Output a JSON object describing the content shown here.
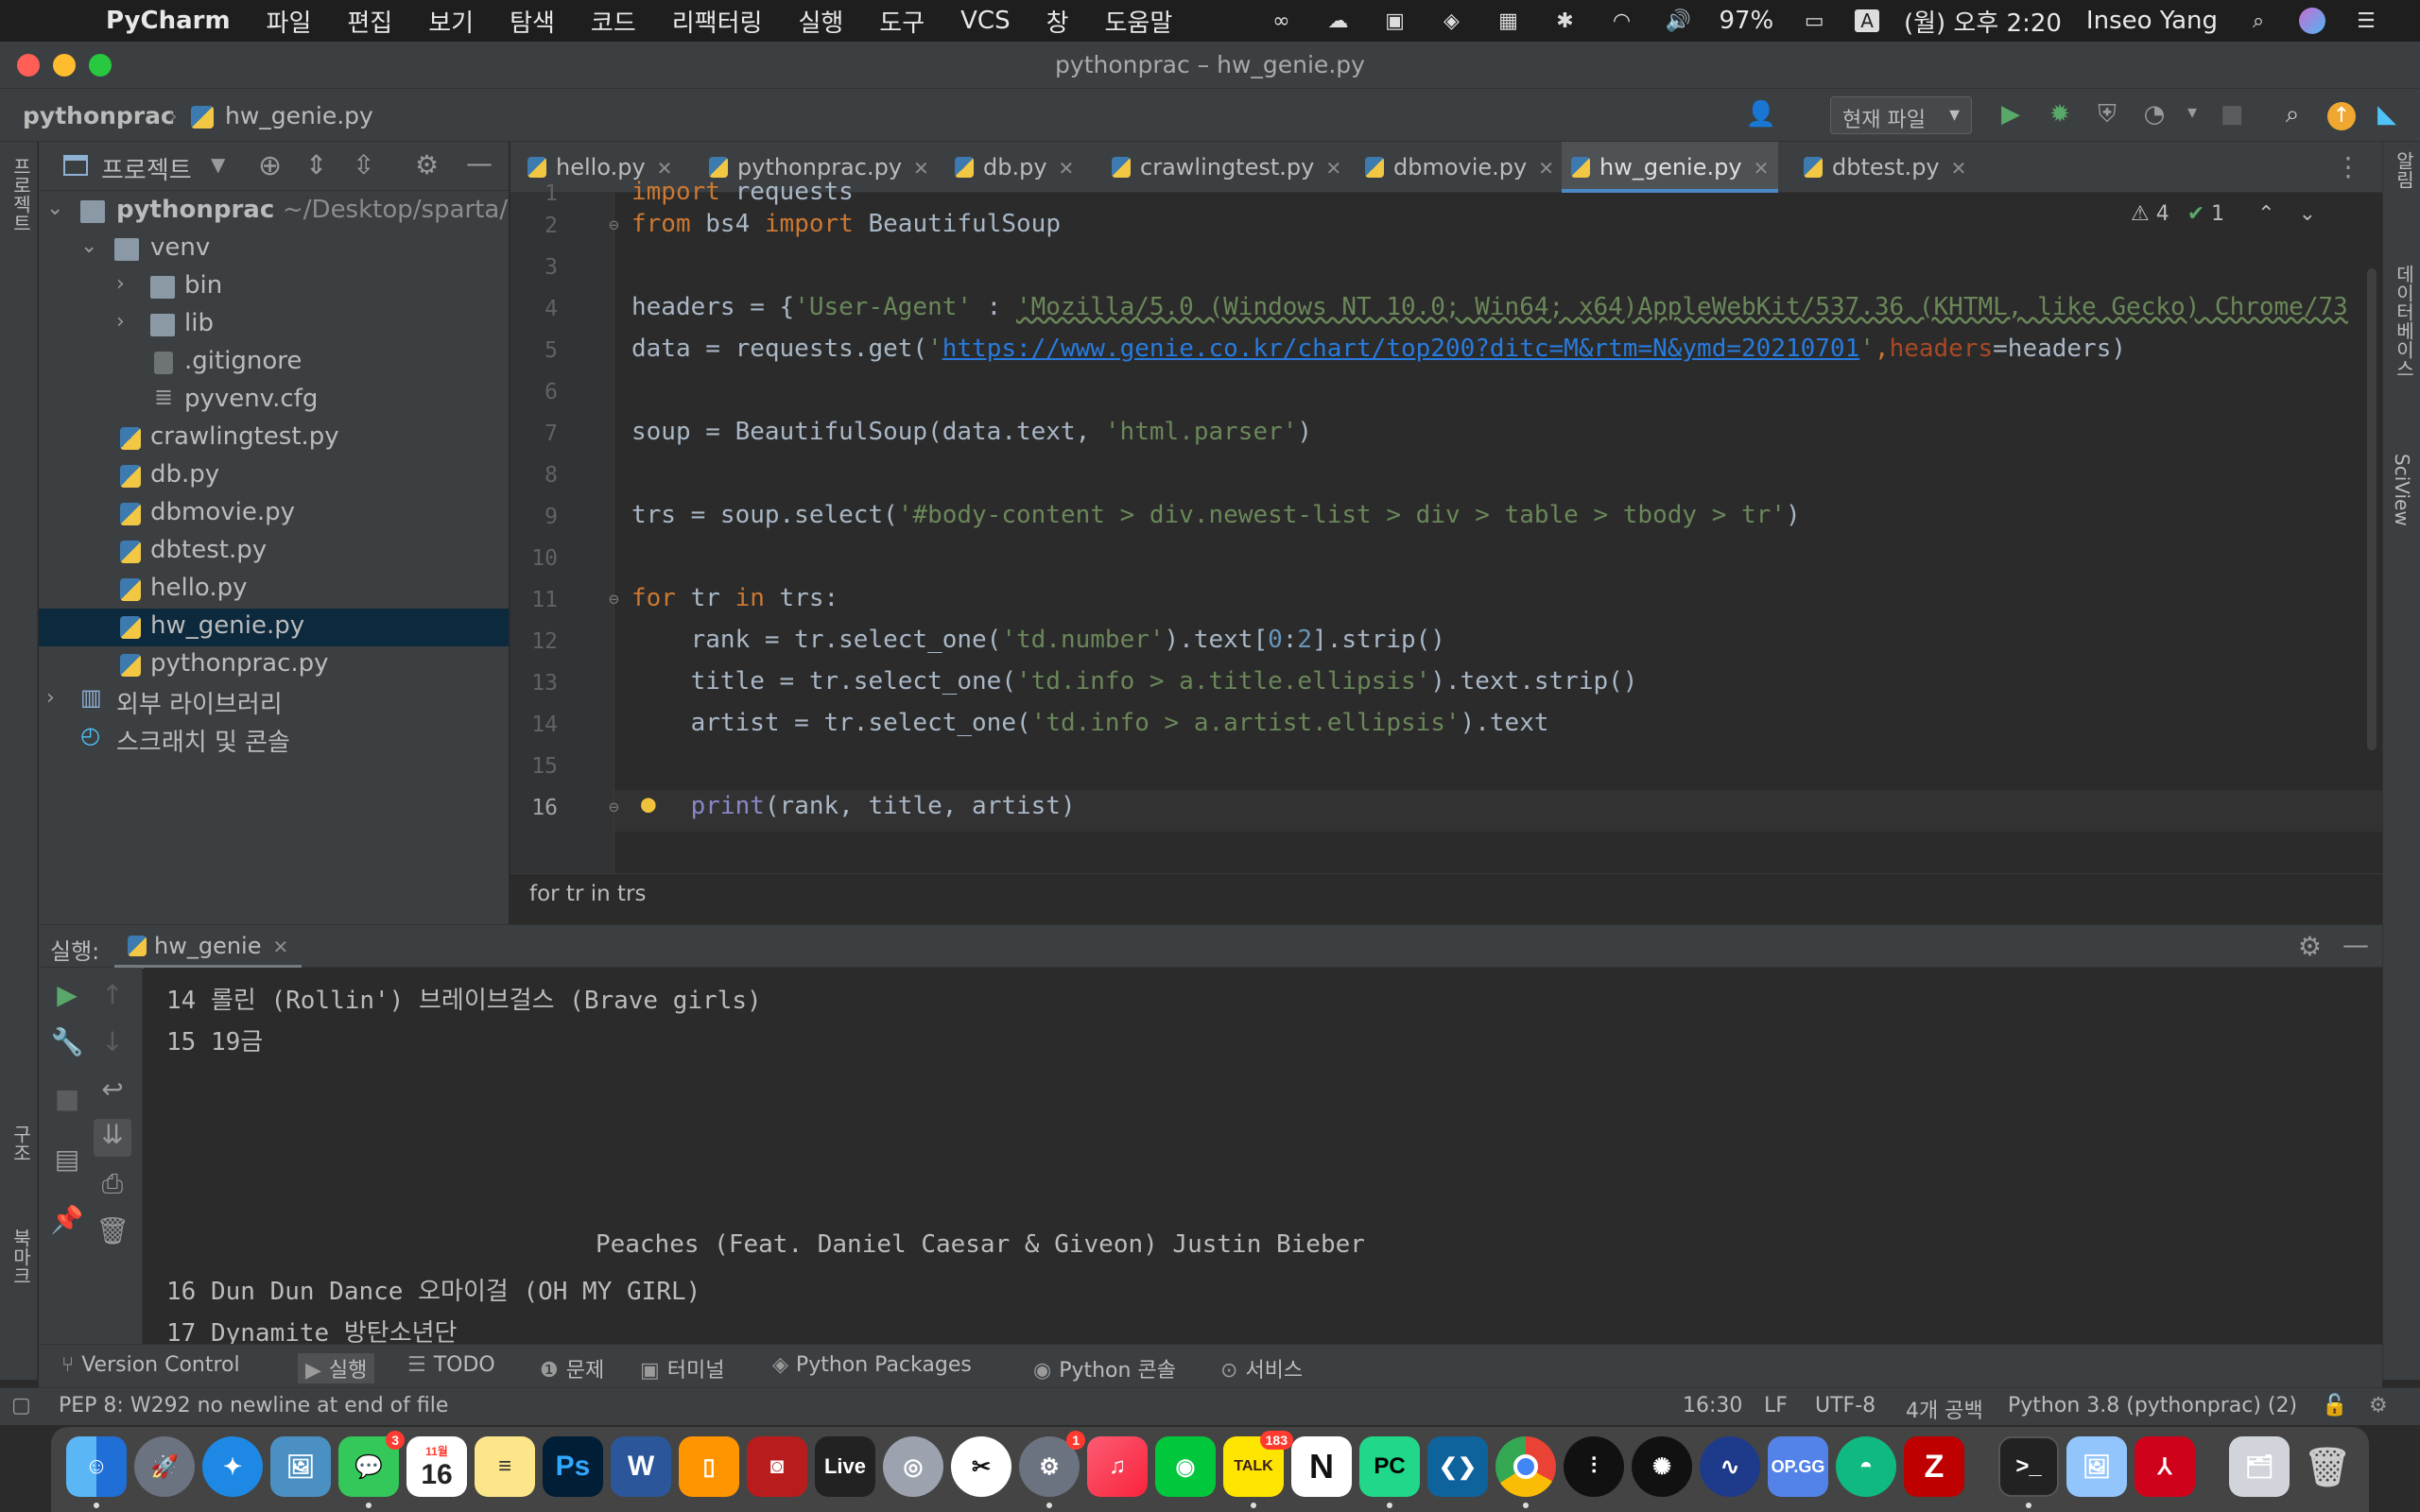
{
  "menubar": {
    "apple": "",
    "app_name": "PyCharm",
    "menus": [
      "파일",
      "편집",
      "보기",
      "탐색",
      "코드",
      "리팩터링",
      "실행",
      "도구",
      "VCS",
      "창",
      "도움말"
    ],
    "battery": "97%",
    "input_source": "A",
    "datetime": "(월) 오후 2:20",
    "user": "Inseo Yang"
  },
  "window": {
    "title": "pythonprac – hw_genie.py"
  },
  "navbar": {
    "project": "pythonprac",
    "file": "hw_genie.py",
    "run_config": "현재 파일"
  },
  "left_stripe": {
    "project_label": "프로젝트",
    "structure_label": "구조",
    "bookmarks_label": "북마크"
  },
  "right_stripe": {
    "notifications_label": "알림",
    "database_label": "데이터베이스",
    "sciview_label": "SciView"
  },
  "project_panel": {
    "title": "프로젝트",
    "root": "pythonprac",
    "root_path": "~/Desktop/sparta/",
    "items": [
      {
        "label": "venv",
        "type": "folder",
        "depth": 1,
        "expanded": true
      },
      {
        "label": "bin",
        "type": "folder",
        "depth": 2,
        "expanded": false
      },
      {
        "label": "lib",
        "type": "folder",
        "depth": 2,
        "expanded": false
      },
      {
        "label": ".gitignore",
        "type": "file",
        "depth": 2
      },
      {
        "label": "pyvenv.cfg",
        "type": "file",
        "depth": 2
      },
      {
        "label": "crawlingtest.py",
        "type": "py",
        "depth": 1
      },
      {
        "label": "db.py",
        "type": "py",
        "depth": 1
      },
      {
        "label": "dbmovie.py",
        "type": "py",
        "depth": 1
      },
      {
        "label": "dbtest.py",
        "type": "py",
        "depth": 1
      },
      {
        "label": "hello.py",
        "type": "py",
        "depth": 1
      },
      {
        "label": "hw_genie.py",
        "type": "py",
        "depth": 1,
        "selected": true
      },
      {
        "label": "pythonprac.py",
        "type": "py",
        "depth": 1
      }
    ],
    "external_libraries": "외부 라이브러리",
    "scratches": "스크래치 및 콘솔"
  },
  "tabs": [
    {
      "label": "hello.py",
      "active": false
    },
    {
      "label": "pythonprac.py",
      "active": false
    },
    {
      "label": "db.py",
      "active": false
    },
    {
      "label": "crawlingtest.py",
      "active": false
    },
    {
      "label": "dbmovie.py",
      "active": false
    },
    {
      "label": "hw_genie.py",
      "active": true
    },
    {
      "label": "dbtest.py",
      "active": false
    }
  ],
  "inspections": {
    "warnings": "4",
    "typos": "1"
  },
  "editor": {
    "line_numbers": [
      "1",
      "2",
      "3",
      "4",
      "5",
      "6",
      "7",
      "8",
      "9",
      "10",
      "11",
      "12",
      "13",
      "14",
      "15",
      "16"
    ],
    "current_line": "16",
    "lines": {
      "l1_kw": "import",
      "l1_rest": " requests",
      "l2_kw1": "from",
      "l2_mod": " bs4 ",
      "l2_kw2": "import",
      "l2_name": " BeautifulSoup",
      "l4_a": "headers = {",
      "l4_s1": "'User-Agent'",
      "l4_b": " : ",
      "l4_s2": "'Mozilla/5.0 (Windows NT 10.0; Win64; x64)AppleWebKit/537.36 (KHTML, like Gecko) Chrome/73",
      "l5_a": "data = requests.get(",
      "l5_q1": "'",
      "l5_url": "https://www.genie.co.kr/chart/top200?ditc=M&rtm=N&ymd=20210701",
      "l5_q2": "'",
      "l5_comma": ",",
      "l5_param": "headers",
      "l5_b": "=headers)",
      "l7_a": "soup = BeautifulSoup(data.text, ",
      "l7_s": "'html.parser'",
      "l7_b": ")",
      "l9_a": "trs = soup.select(",
      "l9_s": "'#body-content > div.newest-list > div > table > tbody > tr'",
      "l9_b": ")",
      "l11_kw1": "for",
      "l11_a": " tr ",
      "l11_kw2": "in",
      "l11_b": " trs:",
      "l12_a": "    rank = tr.select_one(",
      "l12_s": "'td.number'",
      "l12_b": ").text[",
      "l12_n1": "0",
      "l12_c": ":",
      "l12_n2": "2",
      "l12_d": "].strip()",
      "l13_a": "    title = tr.select_one(",
      "l13_s": "'td.info > a.title.ellipsis'",
      "l13_b": ").text.strip()",
      "l14_a": "    artist = tr.select_one(",
      "l14_s": "'td.info > a.artist.ellipsis'",
      "l14_b": ").text",
      "l16_fn": "    print",
      "l16_a": "(rank, title, artist)"
    }
  },
  "editor_breadcrumb": "for tr in trs",
  "run_panel": {
    "label": "실행:",
    "config": "hw_genie",
    "output": [
      "14 롤린 (Rollin') 브레이브걸스 (Brave girls)",
      "15 19금",
      "",
      "",
      "",
      "",
      "                             Peaches (Feat. Daniel Caesar & Giveon) Justin Bieber",
      "16 Dun Dun Dance 오마이걸 (OH MY GIRL)",
      "17 Dynamite 방탄소년단"
    ]
  },
  "tool_windows": [
    "Version Control",
    "실행",
    "TODO",
    "문제",
    "터미널",
    "Python Packages",
    "Python 콘솔",
    "서비스"
  ],
  "statusbar": {
    "message": "PEP 8: W292 no newline at end of file",
    "position": "16:30",
    "line_sep": "LF",
    "encoding": "UTF-8",
    "indent": "4개 공백",
    "interpreter": "Python 3.8 (pythonprac) (2)"
  },
  "dock": {
    "apps": [
      "Finder",
      "Launchpad",
      "Safari",
      "Preview",
      "Messages",
      "Calendar",
      "Notes",
      "Ps",
      "W",
      "Books",
      "Photo Booth",
      "Live",
      "Disk Utility",
      "Script Editor",
      "System Preferences",
      "Music",
      "Whale",
      "TALK",
      "Notion",
      "PC",
      "VS Code",
      "Chrome",
      "Logic",
      "Astro",
      "Audio",
      "OP.GG",
      "Whale Browser",
      "FileZilla",
      "Terminal",
      "Preview 2",
      "Acrobat",
      "Photos",
      "Trash"
    ],
    "calendar_day": "16",
    "calendar_month": "11월",
    "badge_messages": "3",
    "badge_prefs": "1",
    "badge_talk": "183"
  },
  "colors": {
    "keyword": "#cc7832",
    "string": "#6a8759",
    "number": "#6897bb",
    "link": "#287bde",
    "selection": "#0d293e",
    "accent": "#4a88c7"
  }
}
